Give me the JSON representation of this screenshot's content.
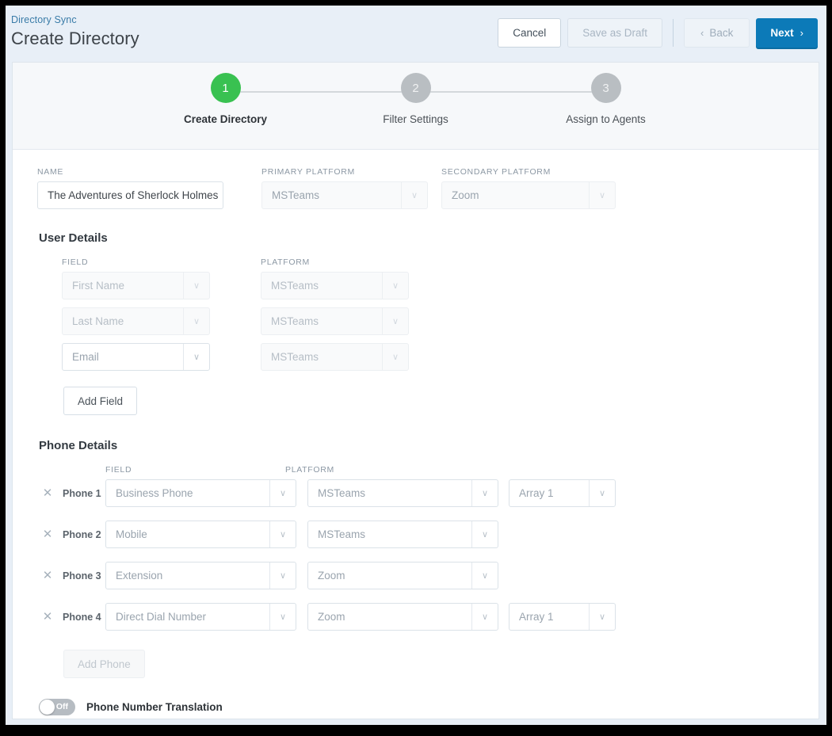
{
  "header": {
    "breadcrumb": "Directory Sync",
    "title": "Create Directory",
    "buttons": {
      "cancel": "Cancel",
      "save_draft": "Save as Draft",
      "back": "Back",
      "next": "Next",
      "back_chevron": "‹",
      "next_chevron": "›"
    },
    "accent_blue": "#0c7ab8",
    "breadcrumb_color": "#3a7ca8"
  },
  "stepper": {
    "active_color": "#39c151",
    "inactive_color": "#b9bec2",
    "steps": [
      {
        "number": "1",
        "label": "Create Directory",
        "state": "active"
      },
      {
        "number": "2",
        "label": "Filter Settings",
        "state": "inactive"
      },
      {
        "number": "3",
        "label": "Assign to Agents",
        "state": "inactive"
      }
    ]
  },
  "form": {
    "name": {
      "label": "NAME",
      "value": "The Adventures of Sherlock Holmes",
      "placeholder": "Name"
    },
    "primary_platform": {
      "label": "PRIMARY PLATFORM",
      "value": "MSTeams"
    },
    "secondary_platform": {
      "label": "SECONDARY PLATFORM",
      "value": "Zoom"
    },
    "user_details": {
      "title": "User Details",
      "col_field": "FIELD",
      "col_platform": "PLATFORM",
      "rows": [
        {
          "field": "First Name",
          "platform": "MSTeams",
          "field_disabled": true,
          "platform_disabled": true
        },
        {
          "field": "Last Name",
          "platform": "MSTeams",
          "field_disabled": true,
          "platform_disabled": true
        },
        {
          "field": "Email",
          "platform": "MSTeams",
          "field_disabled": false,
          "platform_disabled": true
        }
      ],
      "add_button": "Add Field"
    },
    "phone_details": {
      "title": "Phone Details",
      "col_field": "FIELD",
      "col_platform": "PLATFORM",
      "remove_glyph": "✕",
      "rows": [
        {
          "name": "Phone 1",
          "field": "Business Phone",
          "platform": "MSTeams",
          "array": "Array 1",
          "has_array": true
        },
        {
          "name": "Phone 2",
          "field": "Mobile",
          "platform": "MSTeams",
          "array": "",
          "has_array": false
        },
        {
          "name": "Phone 3",
          "field": "Extension",
          "platform": "Zoom",
          "array": "",
          "has_array": false
        },
        {
          "name": "Phone 4",
          "field": "Direct Dial Number",
          "platform": "Zoom",
          "array": "Array 1",
          "has_array": true
        }
      ],
      "add_button": "Add Phone"
    },
    "phone_translation": {
      "toggle_state": "Off",
      "label": "Phone Number Translation"
    },
    "caret_glyph": "∨"
  }
}
